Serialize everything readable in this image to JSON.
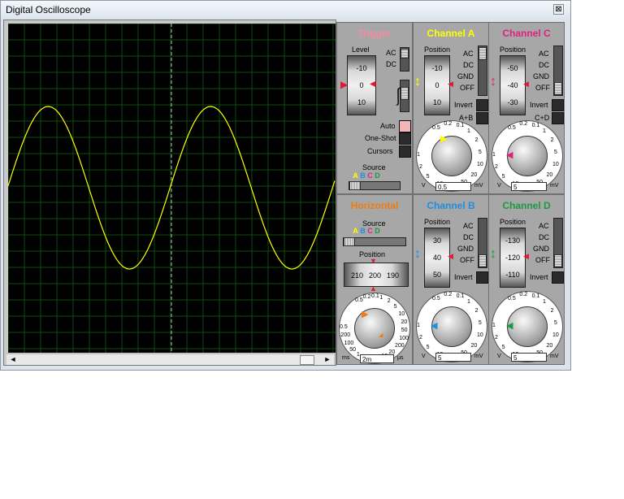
{
  "window": {
    "title": "Digital Oscilloscope",
    "close_glyph": "⊠"
  },
  "colors": {
    "channel_a": "#ffff00",
    "channel_b": "#1e8fe0",
    "channel_c": "#e0207a",
    "channel_d": "#1a9a40",
    "trace": "#ffff00",
    "grid": "#0e4a0e",
    "trigger": "#f48ca0",
    "horizontal": "#f07a10"
  },
  "scroll": {
    "left_glyph": "◄",
    "right_glyph": "►",
    "position": 0.9
  },
  "trigger": {
    "title": "Trigger",
    "level_label": "Level",
    "level_ticks": [
      "-10",
      "0",
      "10"
    ],
    "ac_label": "AC",
    "dc_label": "DC",
    "auto_label": "Auto",
    "oneshot_label": "One-Shot",
    "cursors_label": "Cursors",
    "source_label": "Source",
    "source_options": [
      "A",
      "B",
      "C",
      "D"
    ]
  },
  "channel_a": {
    "title": "Channel A",
    "position_label": "Position",
    "ticks": [
      "-10",
      "0",
      "10"
    ],
    "modes": [
      "AC",
      "DC",
      "GND",
      "OFF"
    ],
    "invert_label": "Invert",
    "combine_label": "A+B",
    "scale_ticks": [
      "0.5",
      "0.2",
      "0.1",
      "1",
      "2",
      "5",
      "10",
      "20",
      "50",
      "20",
      "10",
      "5",
      "2",
      "1"
    ],
    "unit_left": "V",
    "value": "0.5",
    "unit_right": "mV"
  },
  "channel_c": {
    "title": "Channel C",
    "position_label": "Position",
    "ticks": [
      "-50",
      "-40",
      "-30"
    ],
    "modes": [
      "AC",
      "DC",
      "GND",
      "OFF"
    ],
    "invert_label": "Invert",
    "combine_label": "C+D",
    "scale_ticks": [
      "0.5",
      "0.2",
      "0.1",
      "1",
      "2",
      "5",
      "10",
      "20",
      "50",
      "20",
      "10",
      "5",
      "2",
      "1"
    ],
    "unit_left": "V",
    "value": "5",
    "unit_right": "mV"
  },
  "horizontal": {
    "title": "Horizontal",
    "source_label": "Source",
    "source_options": [
      "A",
      "B",
      "C",
      "D"
    ],
    "position_label": "Position",
    "ticks": [
      "210",
      "200",
      "190"
    ],
    "scale_ticks": [
      "0.5",
      "0.2",
      "0.1",
      "1",
      "2",
      "5",
      "10",
      "20",
      "50",
      "100",
      "200",
      "20",
      "10",
      "5",
      "2",
      "1",
      "50",
      "100",
      "200",
      "0.5"
    ],
    "unit_left": "ms",
    "value": "2m",
    "unit_right": "μs"
  },
  "channel_b": {
    "title": "Channel B",
    "position_label": "Position",
    "ticks": [
      "30",
      "40",
      "50"
    ],
    "modes": [
      "AC",
      "DC",
      "GND",
      "OFF"
    ],
    "invert_label": "Invert",
    "scale_ticks": [
      "0.5",
      "0.2",
      "0.1",
      "1",
      "2",
      "5",
      "10",
      "20",
      "50",
      "20",
      "10",
      "5",
      "2",
      "1"
    ],
    "unit_left": "V",
    "value": "5",
    "unit_right": "mV"
  },
  "channel_d": {
    "title": "Channel D",
    "position_label": "Position",
    "ticks": [
      "-130",
      "-120",
      "-110"
    ],
    "modes": [
      "AC",
      "DC",
      "GND",
      "OFF"
    ],
    "invert_label": "Invert",
    "scale_ticks": [
      "0.5",
      "0.2",
      "0.1",
      "1",
      "2",
      "5",
      "10",
      "20",
      "50",
      "20",
      "10",
      "5",
      "2",
      "1"
    ],
    "unit_left": "V",
    "value": "5",
    "unit_right": "mV"
  }
}
